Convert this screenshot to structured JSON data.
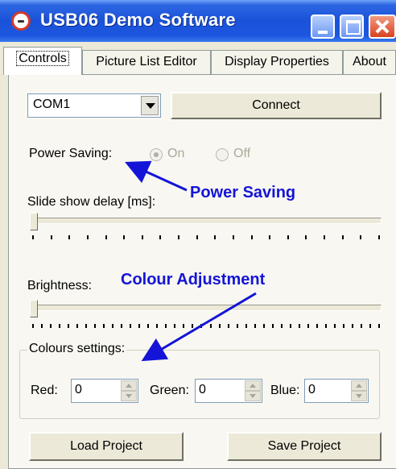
{
  "window": {
    "title": "USB06 Demo Software"
  },
  "tabs": [
    {
      "label": "Controls",
      "active": true
    },
    {
      "label": "Picture List Editor",
      "active": false
    },
    {
      "label": "Display Properties",
      "active": false
    },
    {
      "label": "About",
      "active": false
    }
  ],
  "port": {
    "selected": "COM1"
  },
  "buttons": {
    "connect": "Connect",
    "load": "Load Project",
    "save": "Save Project"
  },
  "power_saving": {
    "label": "Power Saving:",
    "options": [
      "On",
      "Off"
    ],
    "selected": "On",
    "enabled": false
  },
  "slide_delay": {
    "label": "Slide show delay [ms]:",
    "value": 0
  },
  "brightness": {
    "label": "Brightness:",
    "value": 0
  },
  "colours": {
    "title": "Colours settings:",
    "red": {
      "label": "Red:",
      "value": "0"
    },
    "green": {
      "label": "Green:",
      "value": "0"
    },
    "blue": {
      "label": "Blue:",
      "value": "0"
    }
  },
  "annotations": {
    "power_saving": "Power Saving",
    "colour_adjustment": "Colour Adjustment"
  },
  "colors": {
    "annotation": "#1414d8",
    "titlebar": "#1a52d8",
    "close_button": "#d74322"
  }
}
